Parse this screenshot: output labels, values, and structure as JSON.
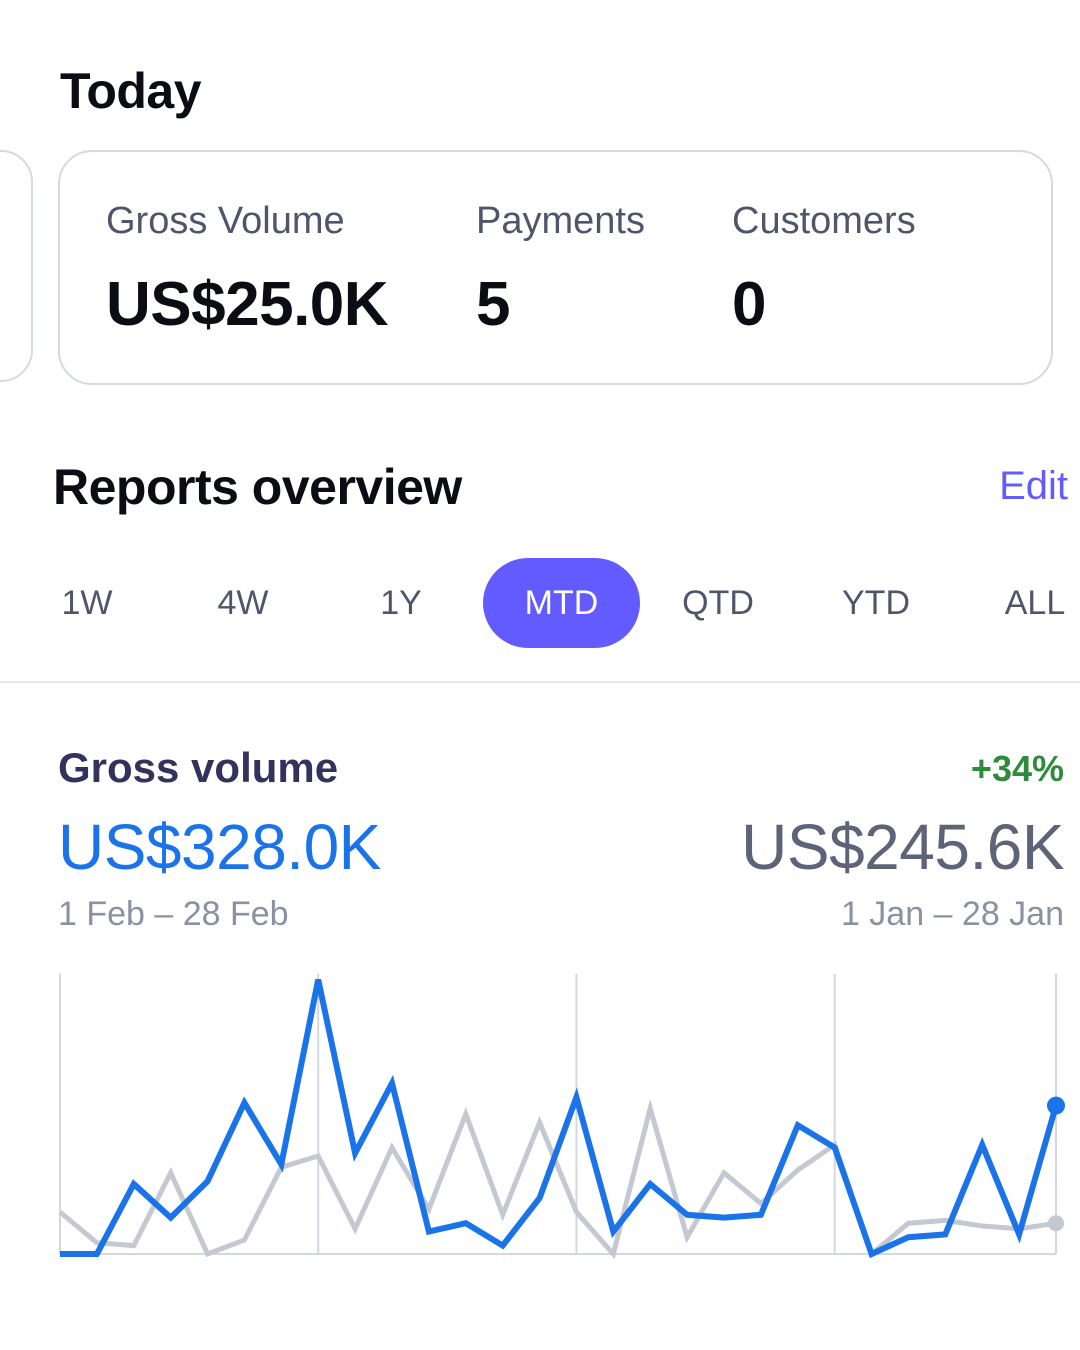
{
  "today": {
    "title": "Today",
    "metrics": [
      {
        "label": "Gross Volume",
        "value": "US$25.0K"
      },
      {
        "label": "Payments",
        "value": "5"
      },
      {
        "label": "Customers",
        "value": "0"
      }
    ]
  },
  "reports": {
    "title": "Reports overview",
    "edit_label": "Edit",
    "ranges": [
      "1W",
      "4W",
      "1Y",
      "MTD",
      "QTD",
      "YTD",
      "ALL"
    ],
    "active_range": "MTD"
  },
  "gross_volume": {
    "title": "Gross volume",
    "change": "+34%",
    "current_value": "US$328.0K",
    "previous_value": "US$245.6K",
    "current_range": "1 Feb – 28 Feb",
    "previous_range": "1 Jan – 28 Jan"
  },
  "colors": {
    "accent": "#635bff",
    "current_series": "#1a73e8",
    "previous_series": "#c4c8d0",
    "positive": "#2e8b3c"
  },
  "chart_data": {
    "type": "line",
    "x": [
      1,
      2,
      3,
      4,
      5,
      6,
      7,
      8,
      9,
      10,
      11,
      12,
      13,
      14,
      15,
      16,
      17,
      18,
      19,
      20,
      21,
      22,
      23,
      24,
      25,
      26,
      27,
      28
    ],
    "ylim": [
      0,
      100
    ],
    "grid_x": [
      1,
      8,
      15,
      22,
      28
    ],
    "series": [
      {
        "values": [
          0,
          0,
          25,
          13,
          26,
          54,
          32,
          98,
          36,
          61,
          8,
          11,
          3,
          20,
          56,
          8,
          25,
          14,
          13,
          14,
          46,
          38,
          0,
          6,
          7,
          39,
          7,
          53
        ]
      },
      {
        "values": [
          15,
          4,
          3,
          29,
          0,
          5,
          31,
          35,
          9,
          38,
          16,
          50,
          14,
          47,
          15,
          0,
          52,
          6,
          29,
          18,
          30,
          39,
          0,
          11,
          12,
          10,
          9,
          11
        ]
      }
    ]
  }
}
